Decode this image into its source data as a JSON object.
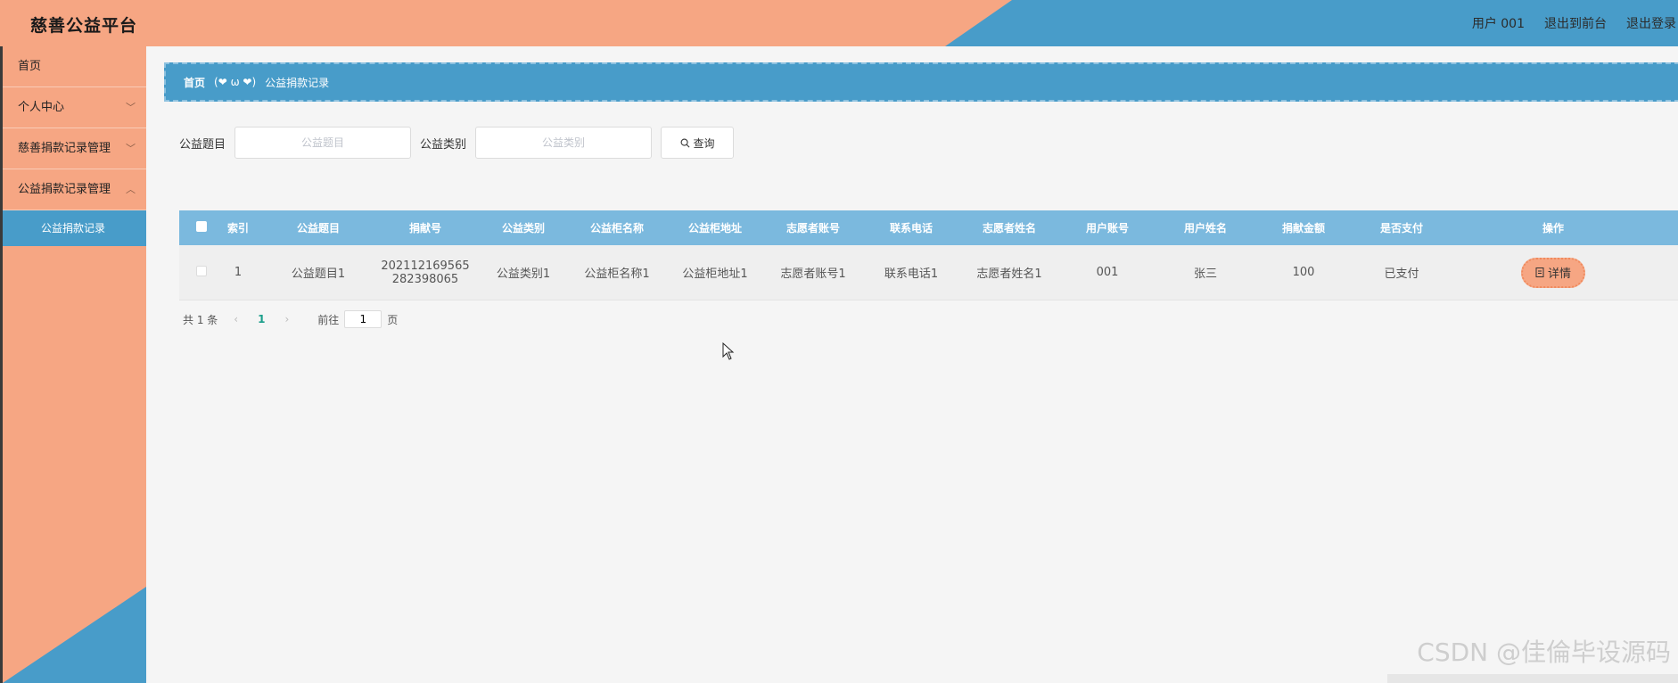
{
  "header": {
    "title": "慈善公益平台",
    "links": [
      "用户 001",
      "退出到前台",
      "退出登录"
    ]
  },
  "sidebar": {
    "items": [
      {
        "label": "首页"
      },
      {
        "label": "个人中心",
        "chevron": "chevron-down-icon"
      },
      {
        "label": "慈善捐款记录管理",
        "chevron": "chevron-down-icon"
      },
      {
        "label": "公益捐款记录管理",
        "chevron": "chevron-up-icon"
      }
    ],
    "active_sub": "公益捐款记录"
  },
  "breadcrumb": {
    "home": "首页",
    "emoji": "(❤ ω ❤)",
    "current": "公益捐款记录"
  },
  "search": {
    "field1_label": "公益题目",
    "field1_placeholder": "公益题目",
    "field2_label": "公益类别",
    "field2_placeholder": "公益类别",
    "button_label": "查询",
    "button_icon": "search-icon"
  },
  "table": {
    "headers": [
      "索引",
      "公益题目",
      "捐献号",
      "公益类别",
      "公益柜名称",
      "公益柜地址",
      "志愿者账号",
      "联系电话",
      "志愿者姓名",
      "用户账号",
      "用户姓名",
      "捐献金额",
      "是否支付",
      "操作"
    ],
    "rows": [
      {
        "index": "1",
        "title": "公益题目1",
        "donation_no_line1": "202112169565",
        "donation_no_line2": "282398065",
        "category": "公益类别1",
        "cabinet_name": "公益柜名称1",
        "cabinet_address": "公益柜地址1",
        "volunteer_account": "志愿者账号1",
        "phone": "联系电话1",
        "volunteer_name": "志愿者姓名1",
        "user_account": "001",
        "user_name": "张三",
        "amount": "100",
        "paid": "已支付",
        "action_label": "详情"
      }
    ]
  },
  "pager": {
    "total": "共 1 条",
    "prev": "‹",
    "current_page": "1",
    "next": "›",
    "goto_label": "前往",
    "goto_value": "1",
    "page_suffix": "页"
  },
  "watermark": "CSDN @佳倫毕设源码",
  "colors": {
    "accent_orange": "#f6a683",
    "accent_blue": "#489cc9",
    "table_header": "#7bb9de"
  }
}
